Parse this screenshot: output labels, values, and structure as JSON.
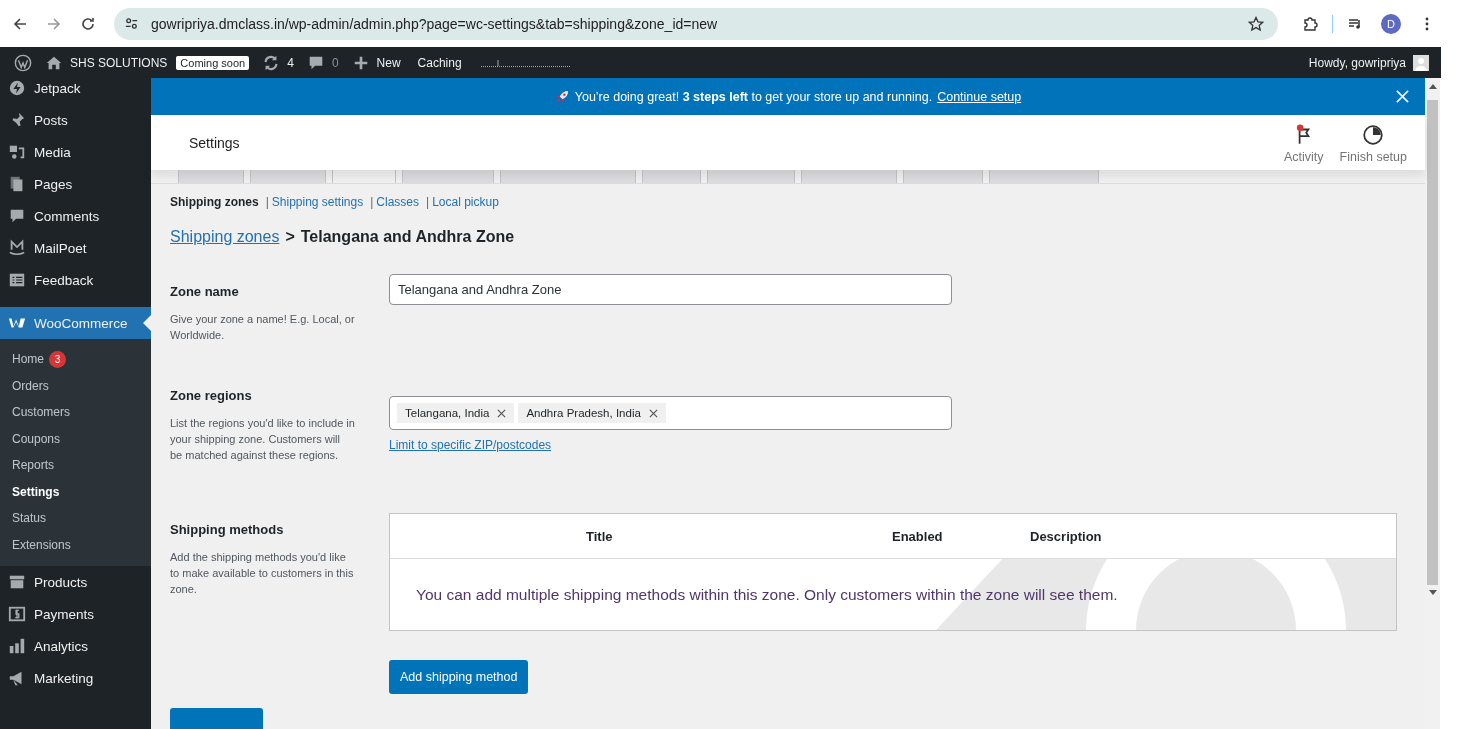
{
  "browser": {
    "url": "gowripriya.dmclass.in/wp-admin/admin.php?page=wc-settings&tab=shipping&zone_id=new",
    "profile_initial": "D"
  },
  "admin_bar": {
    "site_name": "SHS SOLUTIONS",
    "status_badge": "Coming soon",
    "updates_count": "4",
    "comments_count": "0",
    "new_label": "New",
    "caching_label": "Caching",
    "greeting": "Howdy, gowripriya"
  },
  "sidebar": {
    "items": [
      {
        "label": "Jetpack",
        "selected": false
      },
      {
        "label": "Posts",
        "selected": false
      },
      {
        "label": "Media",
        "selected": false
      },
      {
        "label": "Pages",
        "selected": false
      },
      {
        "label": "Comments",
        "selected": false
      },
      {
        "label": "MailPoet",
        "selected": false
      },
      {
        "label": "Feedback",
        "selected": false
      },
      {
        "label": "WooCommerce",
        "selected": true,
        "children": [
          {
            "label": "Home",
            "badge": "3",
            "selected": false
          },
          {
            "label": "Orders",
            "selected": false
          },
          {
            "label": "Customers",
            "selected": false
          },
          {
            "label": "Coupons",
            "selected": false
          },
          {
            "label": "Reports",
            "selected": false
          },
          {
            "label": "Settings",
            "selected": true
          },
          {
            "label": "Status",
            "selected": false
          },
          {
            "label": "Extensions",
            "selected": false
          }
        ]
      },
      {
        "label": "Products",
        "selected": false
      },
      {
        "label": "Payments",
        "selected": false
      },
      {
        "label": "Analytics",
        "selected": false
      },
      {
        "label": "Marketing",
        "selected": false
      }
    ]
  },
  "notice": {
    "text": "You’re doing great! **3 steps left** to get your store up and running.",
    "link": "Continue setup"
  },
  "header": {
    "title": "Settings",
    "actions": [
      {
        "label": "Activity",
        "unread": true
      },
      {
        "label": "Finish setup",
        "unread": false
      }
    ]
  },
  "tabs": [
    {
      "selected": false
    },
    {
      "selected": false
    },
    {
      "selected": true
    },
    {
      "selected": false
    },
    {
      "selected": false
    },
    {
      "selected": false
    },
    {
      "selected": false
    },
    {
      "selected": false
    },
    {
      "selected": false
    },
    {
      "selected": false
    }
  ],
  "subnav": [
    {
      "label": "Shipping zones",
      "selected": true
    },
    {
      "separator": "|",
      "label": "Shipping settings",
      "selected": false
    },
    {
      "separator": "|",
      "label": "Classes",
      "selected": false
    },
    {
      "separator": "|",
      "label": "Local pickup",
      "selected": false
    }
  ],
  "breadcrumb": {
    "link": "Shipping zones",
    "separator": ">",
    "current": "Telangana and Andhra Zone"
  },
  "zone_name": {
    "label": "Zone name",
    "description": "Give your zone a name! E.g. Local, or Worldwide.",
    "value": "Telangana and Andhra Zone"
  },
  "zone_regions": {
    "label": "Zone regions",
    "description": "List the regions you'd like to include in your shipping zone. Customers will be matched against these regions.",
    "tags": [
      "Telangana, India",
      "Andhra Pradesh, India"
    ],
    "link": "Limit to specific ZIP/postcodes"
  },
  "shipping_methods": {
    "label": "Shipping methods",
    "description": "Add the shipping methods you'd like to make available to customers in this zone.",
    "columns": [
      "Title",
      "Enabled",
      "Description"
    ],
    "empty_message": "You can add multiple shipping methods within this zone. Only customers within the zone will see them.",
    "button": "Add shipping method"
  }
}
